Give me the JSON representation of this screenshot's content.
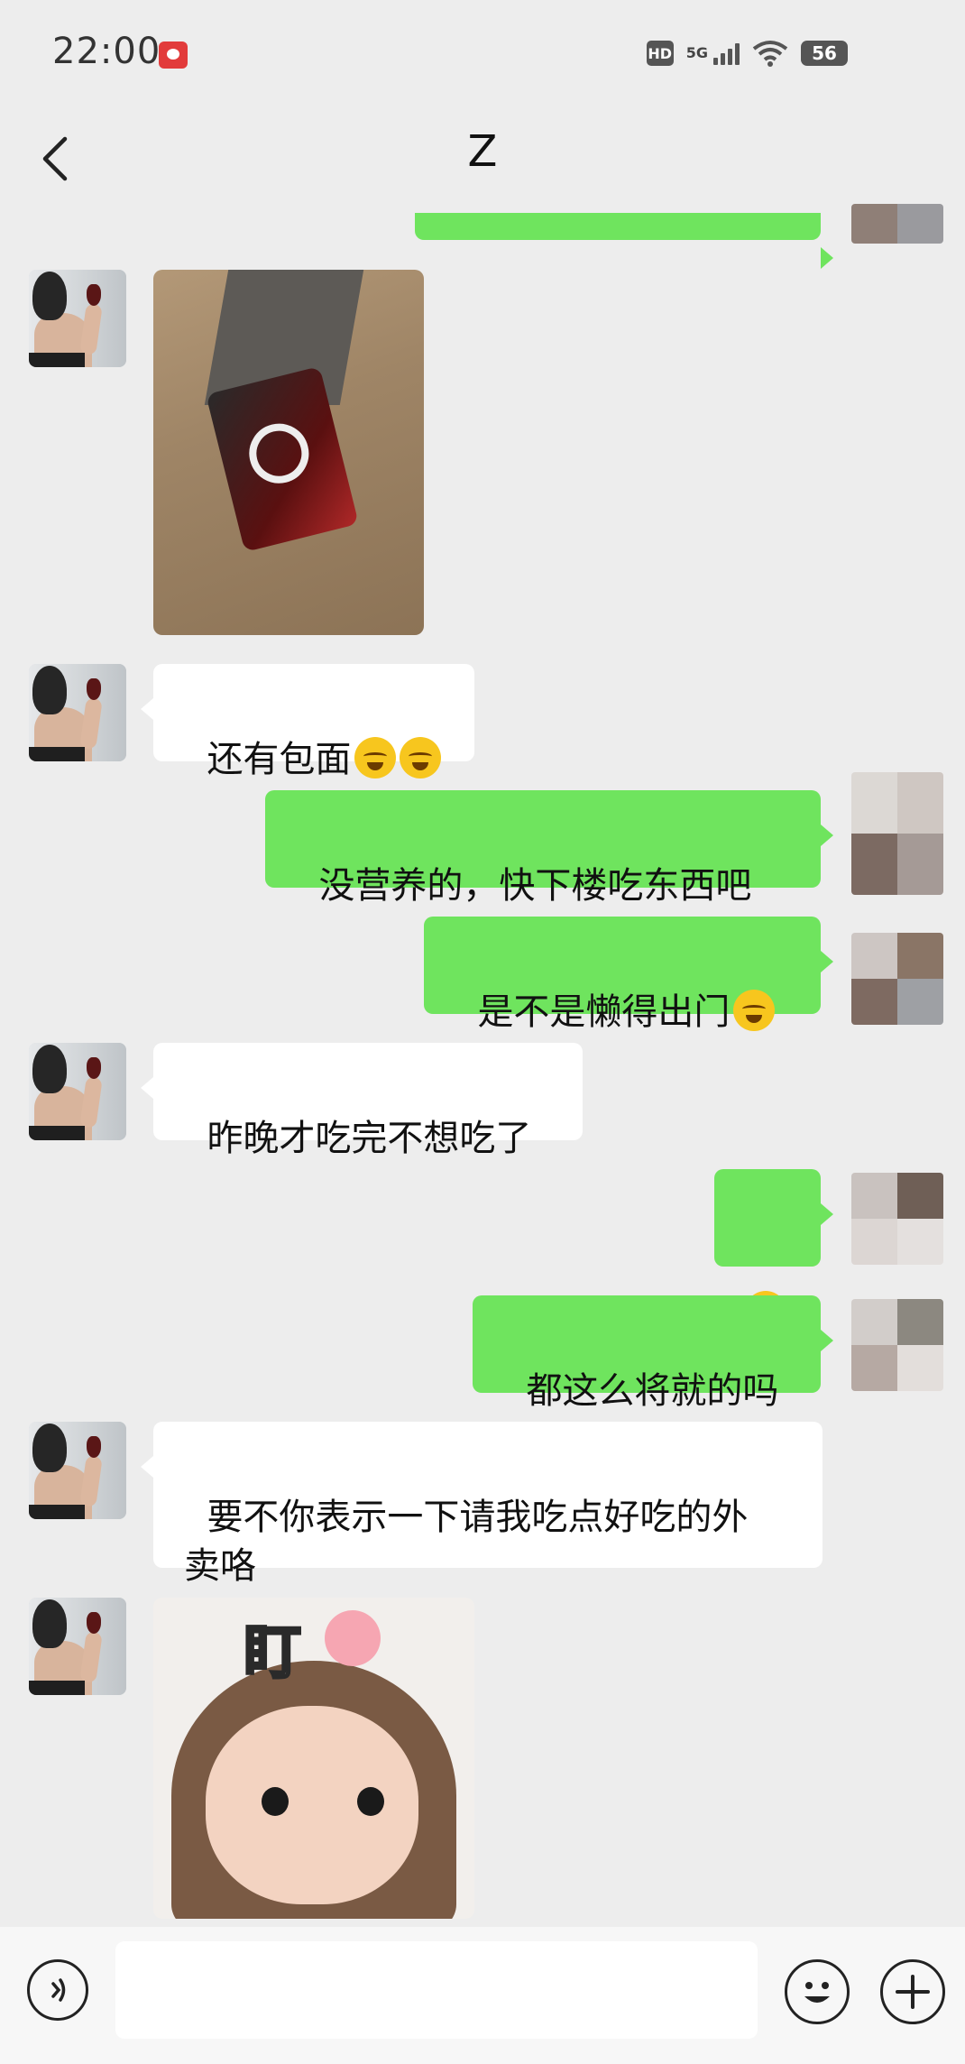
{
  "status_bar": {
    "time": "22:00",
    "app_icon": "red-app-notification-icon",
    "hd": "HD",
    "network": "5G",
    "battery": "56"
  },
  "nav": {
    "title": "Z",
    "back_icon": "chevron-left-icon"
  },
  "messages": [
    {
      "side": "right",
      "type": "text",
      "text": "",
      "note": "partially cropped green bubble at top"
    },
    {
      "side": "left",
      "type": "image",
      "image": "photo-instant-noodle-box"
    },
    {
      "side": "left",
      "type": "text",
      "text": "还有包面",
      "emoji": [
        "crying-face",
        "crying-face"
      ]
    },
    {
      "side": "right",
      "type": "text",
      "text": "没营养的，快下楼吃东西吧"
    },
    {
      "side": "right",
      "type": "text",
      "text": "是不是懒得出门",
      "emoji": [
        "laughing-crying-face"
      ]
    },
    {
      "side": "left",
      "type": "text",
      "text": "昨晚才吃完不想吃了"
    },
    {
      "side": "right",
      "type": "text",
      "text": "",
      "emoji": [
        "laughing-crying-face"
      ]
    },
    {
      "side": "right",
      "type": "text",
      "text": "都这么将就的吗"
    },
    {
      "side": "left",
      "type": "text",
      "text": "要不你表示一下请我吃点好吃的外\n卖咯"
    },
    {
      "side": "left",
      "type": "image",
      "image": "sticker-girl-staring",
      "sticker_text": "盯"
    }
  ],
  "input_bar": {
    "voice_icon": "voice-icon",
    "emoji_icon": "emoji-icon",
    "plus_icon": "plus-icon"
  }
}
